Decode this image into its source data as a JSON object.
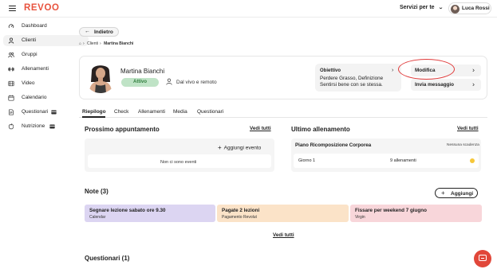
{
  "app": {
    "logo": "REVOO"
  },
  "header": {
    "services_label": "Servizi per te",
    "user_name": "Luca Rossi"
  },
  "sidebar": {
    "items": [
      {
        "label": "Dashboard",
        "icon": "dashboard-icon"
      },
      {
        "label": "Clienti",
        "icon": "user-icon",
        "active": true
      },
      {
        "label": "Gruppi",
        "icon": "group-icon"
      },
      {
        "label": "Allenamenti",
        "icon": "dumbbell-icon"
      },
      {
        "label": "Video",
        "icon": "film-icon"
      },
      {
        "label": "Calendario",
        "icon": "calendar-icon"
      },
      {
        "label": "Questionari",
        "icon": "document-icon"
      },
      {
        "label": "Nutrizione",
        "icon": "nutrition-icon"
      }
    ]
  },
  "back_label": "Indietro",
  "breadcrumb": {
    "home": "⌂",
    "items": [
      "Clienti",
      "Martina Bianchi"
    ]
  },
  "profile": {
    "name": "Martina Bianchi",
    "status": "Attivo",
    "mode": "Dal vivo e remoto",
    "goal_title": "Obiettivo",
    "goal_text": "Perdere Grasso, Definizione Sentirsi bene con se stessa.",
    "edit_label": "Modifica",
    "message_label": "Invia messaggio"
  },
  "tabs": [
    "Riepilogo",
    "Check",
    "Allenamenti",
    "Media",
    "Questionari"
  ],
  "appointment": {
    "title": "Prossimo appuntamento",
    "see_all": "Vedi tutti",
    "add_event": "Aggiungi evento",
    "empty": "Non ci sono eventi"
  },
  "last_workout": {
    "title": "Ultimo allenamento",
    "see_all": "Vedi tutti",
    "plan": "Piano Ricomposizione Corporea",
    "expiry": "Nessuna scadenza",
    "day": "Giorno 1",
    "workouts": "9 allenamenti"
  },
  "notes": {
    "title": "Note (3)",
    "add_label": "Aggiungi",
    "see_all": "Vedi tutti",
    "items": [
      {
        "title": "Segnare lezione sabato ore 9.30",
        "source": "Calendar",
        "color": "#dcd5f2"
      },
      {
        "title": "Pagate 2 lezioni",
        "source": "Pagamento Revolut",
        "color": "#fbe3c8"
      },
      {
        "title": "Fissare per weekend 7 giugno",
        "source": "Virgin",
        "color": "#f8d6da"
      }
    ]
  },
  "questionnaires": {
    "title": "Questionari (1)"
  },
  "colors": {
    "brand": "#e8533e",
    "active_badge": "#bfe3c6",
    "highlight_oval": "#e03a3a"
  }
}
